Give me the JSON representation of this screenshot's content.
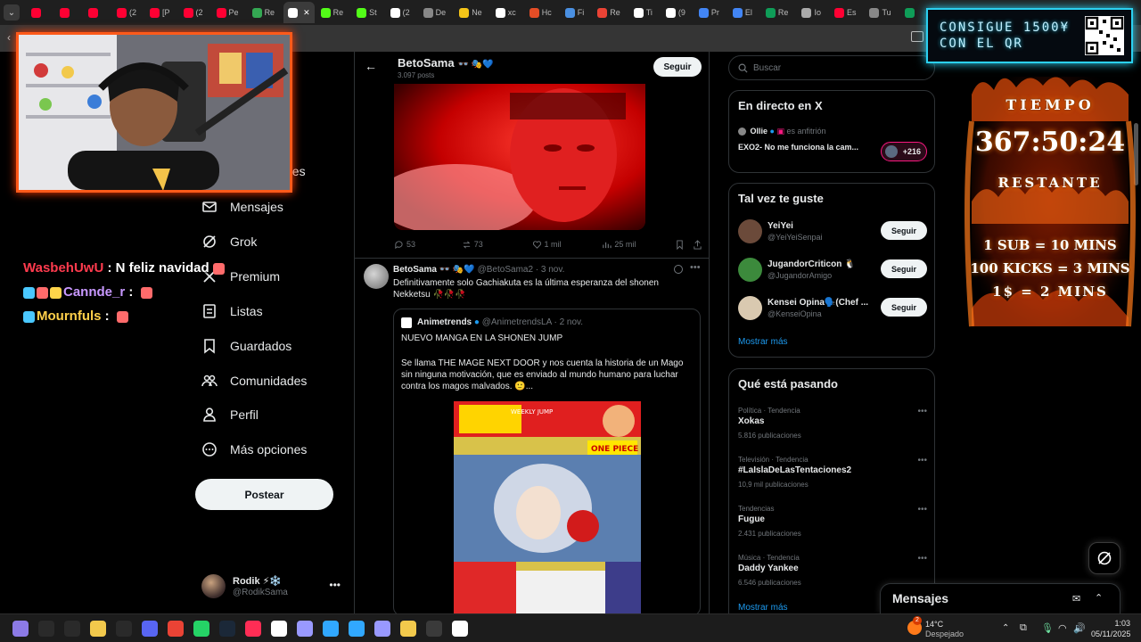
{
  "browser": {
    "tabs": [
      {
        "label": "",
        "color": "#ff0033"
      },
      {
        "label": "",
        "color": "#ff0033"
      },
      {
        "label": "",
        "color": "#ff0033"
      },
      {
        "label": "(2",
        "color": "#ff0033"
      },
      {
        "label": "[P",
        "color": "#ff0033"
      },
      {
        "label": "(2",
        "color": "#ff0033"
      },
      {
        "label": "Pe",
        "color": "#ff0033"
      },
      {
        "label": "Re",
        "color": "#34a853"
      },
      {
        "label": "",
        "color": "#ffffff",
        "active": true
      },
      {
        "label": "Re",
        "color": "#53fc18"
      },
      {
        "label": "St",
        "color": "#53fc18"
      },
      {
        "label": "(2",
        "color": "#ffffff"
      },
      {
        "label": "De",
        "color": "#888888"
      },
      {
        "label": "Ne",
        "color": "#f5c518"
      },
      {
        "label": "xc",
        "color": "#ffffff"
      },
      {
        "label": "Hc",
        "color": "#e44d26"
      },
      {
        "label": "Fi",
        "color": "#4a90e2"
      },
      {
        "label": "Re",
        "color": "#ea4335"
      },
      {
        "label": "Ti",
        "color": "#ffffff"
      },
      {
        "label": "(9",
        "color": "#ffffff"
      },
      {
        "label": "Pr",
        "color": "#4285f4"
      },
      {
        "label": "El",
        "color": "#4285f4"
      },
      {
        "label": "Re",
        "color": "#0f9d58"
      },
      {
        "label": "Io",
        "color": "#aaaaaa"
      },
      {
        "label": "Es",
        "color": "#ff0033"
      },
      {
        "label": "Tu",
        "color": "#888888"
      },
      {
        "label": "",
        "color": "#0f9d58"
      }
    ]
  },
  "nav": {
    "ghost_label": "nes",
    "items": [
      {
        "label": "Mensajes",
        "icon": "mail-icon"
      },
      {
        "label": "Grok",
        "icon": "grok-icon"
      },
      {
        "label": "Premium",
        "icon": "x-logo-icon"
      },
      {
        "label": "Listas",
        "icon": "list-icon"
      },
      {
        "label": "Guardados",
        "icon": "bookmark-icon"
      },
      {
        "label": "Comunidades",
        "icon": "communities-icon"
      },
      {
        "label": "Perfil",
        "icon": "person-icon"
      },
      {
        "label": "Más opciones",
        "icon": "more-circle-icon"
      }
    ],
    "post_button": "Postear",
    "account": {
      "name": "Rodik ⚡❄️",
      "handle": "@RodikSama"
    }
  },
  "profile_header": {
    "name": "BetoSama",
    "badges": "👓 🎭💙",
    "posts": "3.097 posts",
    "follow": "Seguir"
  },
  "tweet1": {
    "replies": "53",
    "reposts": "73",
    "likes": "1 mil",
    "views": "25 mil"
  },
  "tweet2": {
    "name": "BetoSama",
    "badges": "👓 🎭💙",
    "meta": "@BetoSama2 · 3 nov.",
    "text": "Definitivamente solo Gachiakuta es la última esperanza del shonen Nekketsu 🥀🥀🥀",
    "quote": {
      "name": "Animetrends",
      "meta": "@AnimetrendsLA · 2 nov.",
      "title": "NUEVO MANGA EN LA SHONEN JUMP",
      "body": "Se llama THE MAGE NEXT DOOR y nos cuenta la historia de un Mago sin ninguna motivación, que es enviado al mundo humano para luchar contra los magos malvados. 🙂...",
      "cover_texts": [
        "WEEKLY JUMP",
        "ONE PIECE"
      ]
    }
  },
  "right": {
    "search_placeholder": "Buscar",
    "live": {
      "title": "En directo en X",
      "host": "Ollie",
      "role": "es anfitrión",
      "space_title": "EXO2- No me funciona la cam...",
      "count": "+216"
    },
    "who_to_follow": {
      "title": "Tal vez te guste",
      "users": [
        {
          "name": "YeiYei",
          "handle": "@YeiYeiSenpai",
          "button": "Seguir",
          "color": "#6b4a3a"
        },
        {
          "name": "JugandorCriticon 🐧",
          "handle": "@JugandorAmigo",
          "button": "Seguir",
          "color": "#3c8a3c"
        },
        {
          "name": "Kensei Opina🗣️(Chef ...",
          "handle": "@KenseiOpina",
          "button": "Seguir",
          "color": "#d9c9b0"
        }
      ],
      "more": "Mostrar más"
    },
    "trends": {
      "title": "Qué está pasando",
      "items": [
        {
          "context": "Política · Tendencia",
          "topic": "Xokas",
          "posts": "5.816 publicaciones"
        },
        {
          "context": "Televisión · Tendencia",
          "topic": "#LaIslaDeLasTentaciones2",
          "posts": "10,9 mil publicaciones"
        },
        {
          "context": "Tendencias",
          "topic": "Fugue",
          "posts": "2.431 publicaciones"
        },
        {
          "context": "Música · Tendencia",
          "topic": "Daddy Yankee",
          "posts": "6.546 publicaciones"
        }
      ],
      "more": "Mostrar más"
    },
    "messages_drawer": "Mensajes"
  },
  "stream": {
    "chat": [
      {
        "user": "WasbehUwU",
        "text": "N feliz navidad",
        "user_color": "#ff3b4e"
      },
      {
        "user": "Cannde_r",
        "text": "",
        "user_color": "#c898ff"
      },
      {
        "user": "Mournfuls",
        "text": "",
        "user_color": "#ffd04a"
      }
    ],
    "qr_banner": "CONSIGUE 1500¥ CON EL QR",
    "timer": {
      "label_top": "TIEMPO",
      "time": "367:50:24",
      "label_bottom": "RESTANTE",
      "rule1": "1 SUB = 10 MINS",
      "rule2": "100 KICKS = 3 MINS",
      "rule3": "1$ = 2 MINS"
    }
  },
  "taskbar": {
    "weather_temp": "14°C",
    "weather_text": "Despejado",
    "weather_badge": "2",
    "time": "1:03",
    "date": "05/11/2025",
    "icons": [
      "character-icon",
      "search-icon",
      "task-view-icon",
      "file-explorer-icon",
      "mail-icon",
      "discord-icon",
      "chrome-icon",
      "whatsapp-icon",
      "steam-icon",
      "tiktok-icon",
      "app-icon",
      "audition-icon",
      "lightroom-icon",
      "photoshop-icon",
      "premiere-icon",
      "chrome-dev-icon",
      "terminal-icon",
      "game-icon"
    ]
  }
}
